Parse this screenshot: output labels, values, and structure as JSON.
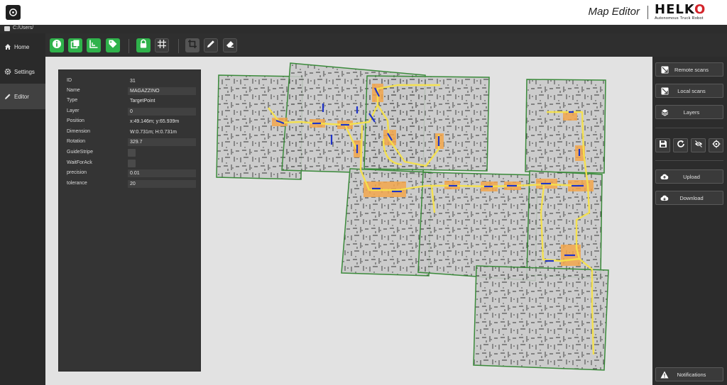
{
  "header": {
    "title": "Map Editor",
    "brand": {
      "name_start": "HELK",
      "name_o": "O",
      "tagline": "Autonomous Truck Robot"
    },
    "brand_accent": "#d3242a"
  },
  "path": "C:/Users/",
  "sidebar": {
    "items": [
      {
        "label": "Home",
        "icon": "home-icon"
      },
      {
        "label": "Settings",
        "icon": "gear-icon"
      },
      {
        "label": "Editor",
        "icon": "pencil-icon",
        "active": true
      }
    ]
  },
  "toolbar": {
    "buttons": [
      "info-icon",
      "layers-copy-icon",
      "axes-icon",
      "tag-icon",
      "lock-icon",
      "grid-icon",
      "crop-icon",
      "pencil-icon",
      "eraser-icon"
    ],
    "accent": "#2fb24b"
  },
  "properties": {
    "rows": [
      {
        "label": "ID",
        "value": "31"
      },
      {
        "label": "Name",
        "value": "MAGAZZINO"
      },
      {
        "label": "Type",
        "value": "TargetPoint"
      },
      {
        "label": "Layer",
        "value": "0"
      },
      {
        "label": "Position",
        "value": "x:49.146m; y:65.939m"
      },
      {
        "label": "Dimension",
        "value": "W:0.731m; H:0.731m"
      },
      {
        "label": "Rotation",
        "value": "329.7"
      },
      {
        "label": "GuideStripe",
        "value": ""
      },
      {
        "label": "WaitForAck",
        "value": ""
      },
      {
        "label": "precision",
        "value": "0.01"
      },
      {
        "label": "tolerance",
        "value": "20"
      }
    ]
  },
  "right_panel": {
    "remote_scans": "Remote scans",
    "local_scans": "Local scans",
    "layers": "Layers",
    "upload": "Upload",
    "download": "Download",
    "notifications": "Notifications"
  },
  "map_colors": {
    "scan_border": "#3a8a3a",
    "path": "#f5e14a",
    "zone": "#f2a64b",
    "marker": "#1f33c9"
  }
}
